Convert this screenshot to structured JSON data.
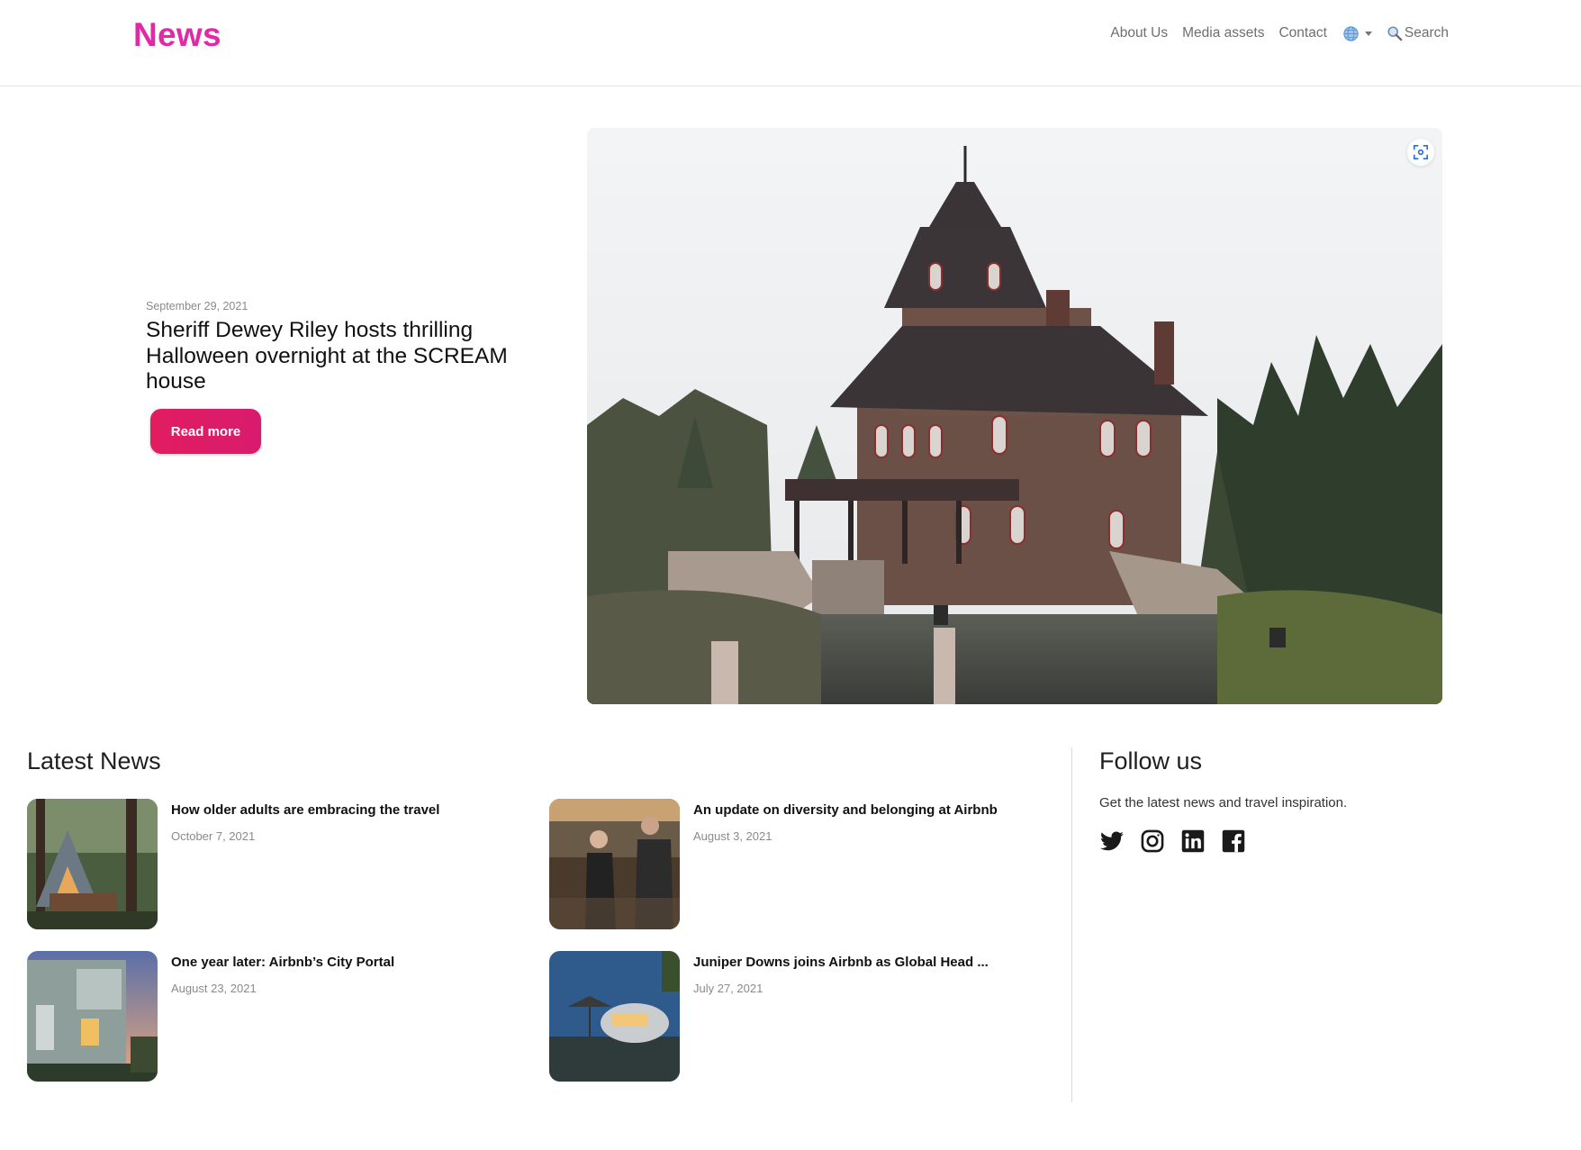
{
  "header": {
    "logo": "News",
    "nav": {
      "about": "About Us",
      "media": "Media assets",
      "contact": "Contact",
      "search": "Search"
    }
  },
  "hero": {
    "date": "September 29, 2021",
    "title": "Sheriff Dewey Riley hosts thrilling Halloween overnight at the SCREAM house",
    "button": "Read more"
  },
  "latest": {
    "title": "Latest News",
    "items": [
      {
        "title": "How older adults are embracing the travel",
        "date": "October 7, 2021"
      },
      {
        "title": "An update on diversity and belonging at Airbnb",
        "date": "August 3, 2021"
      },
      {
        "title": "One year later: Airbnb’s City Portal",
        "date": "August 23, 2021"
      },
      {
        "title": "Juniper Downs joins Airbnb as Global Head ...",
        "date": "July 27, 2021"
      }
    ]
  },
  "follow": {
    "title": "Follow us",
    "subtitle": "Get the latest news and travel inspiration.",
    "icons": [
      "twitter-icon",
      "instagram-icon",
      "linkedin-icon",
      "facebook-icon"
    ]
  },
  "colors": {
    "brand": "#e02aa6",
    "button": "#e11d60"
  }
}
